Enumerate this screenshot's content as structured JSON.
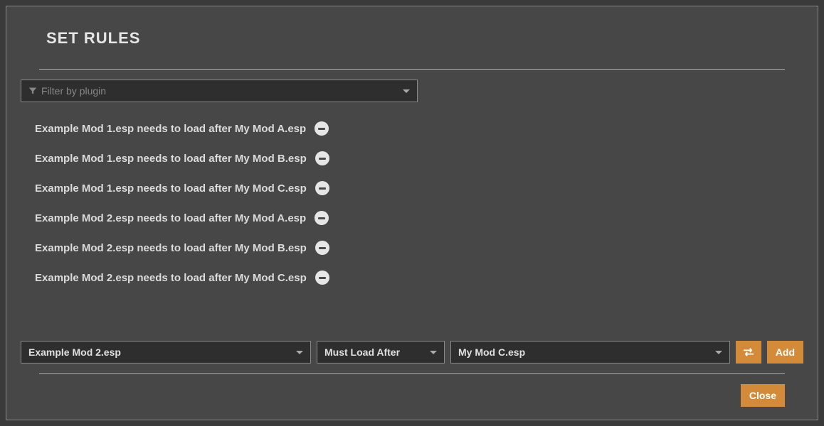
{
  "dialog": {
    "title": "SET RULES"
  },
  "filter": {
    "placeholder": "Filter by plugin"
  },
  "rules": [
    {
      "text": "Example Mod 1.esp needs to load after My Mod A.esp"
    },
    {
      "text": "Example Mod 1.esp needs to load after My Mod B.esp"
    },
    {
      "text": "Example Mod 1.esp needs to load after My Mod C.esp"
    },
    {
      "text": "Example Mod 2.esp needs to load after My Mod A.esp"
    },
    {
      "text": "Example Mod 2.esp needs to load after My Mod B.esp"
    },
    {
      "text": "Example Mod 2.esp needs to load after My Mod C.esp"
    }
  ],
  "addRule": {
    "plugin1": "Example Mod 2.esp",
    "ruleType": "Must Load After",
    "plugin2": "My Mod C.esp",
    "addLabel": "Add"
  },
  "footer": {
    "closeLabel": "Close"
  }
}
